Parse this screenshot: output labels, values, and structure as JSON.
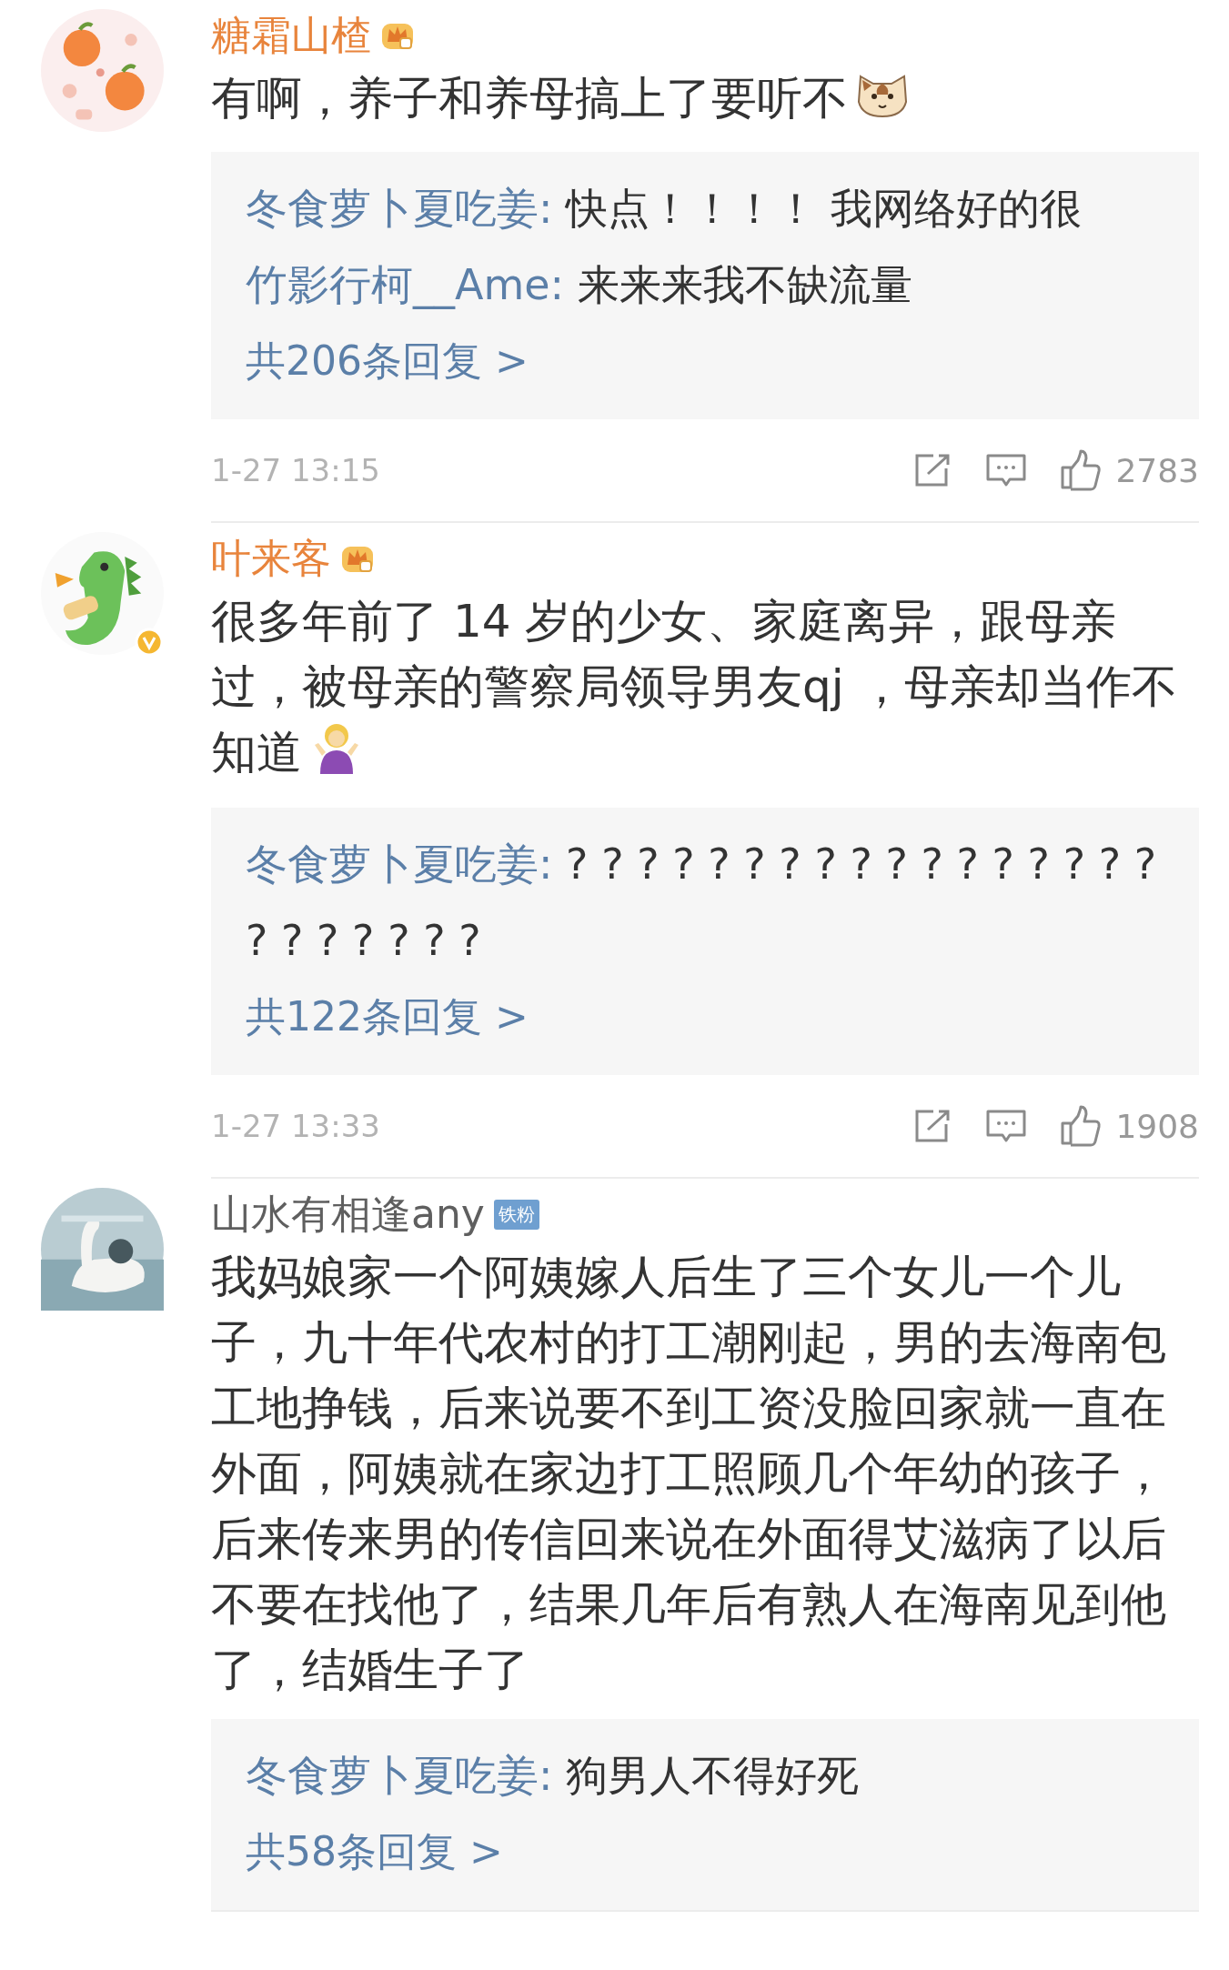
{
  "comments": [
    {
      "name": "糖霜山楂",
      "vip": true,
      "badge": {
        "kind": "crown"
      },
      "verified": false,
      "text": "有啊，养子和养母搞上了要听不",
      "has_emoji": true,
      "replies": [
        {
          "author": "冬食萝卜夏吃姜:",
          "text": "快点！！！！ 我网络好的很"
        },
        {
          "author": "竹影行柯__Ame:",
          "text": "来来来我不缺流量"
        }
      ],
      "reply_count": "共206条回复 >",
      "time": "1-27 13:15",
      "likes": "2783"
    },
    {
      "name": "叶来客",
      "vip": true,
      "badge": {
        "kind": "crown"
      },
      "verified": true,
      "text": "很多年前了 14 岁的少女、家庭离异，跟母亲过，被母亲的警察局领导男友qj ，母亲却当作不知道",
      "has_emoji": true,
      "replies": [
        {
          "author": "冬食萝卜夏吃姜:",
          "text": "? ? ? ? ? ? ? ? ? ? ? ? ? ? ? ? ? ? ? ? ? ? ? ?"
        }
      ],
      "reply_count": "共122条回复 >",
      "time": "1-27 13:33",
      "likes": "1908"
    },
    {
      "name": "山水有相逢any",
      "vip": false,
      "badge": {
        "kind": "label",
        "text": "铁粉"
      },
      "verified": false,
      "text": "我妈娘家一个阿姨嫁人后生了三个女儿一个儿子，九十年代农村的打工潮刚起，男的去海南包工地挣钱，后来说要不到工资没脸回家就一直在外面，阿姨就在家边打工照顾几个年幼的孩子，后来传来男的传信回来说在外面得艾滋病了以后不要在找他了，结果几年后有熟人在海南见到他了，结婚生子了",
      "has_emoji": false,
      "replies": [
        {
          "author": "冬食萝卜夏吃姜:",
          "text": "狗男人不得好死"
        }
      ],
      "reply_count": "共58条回复 >"
    }
  ]
}
